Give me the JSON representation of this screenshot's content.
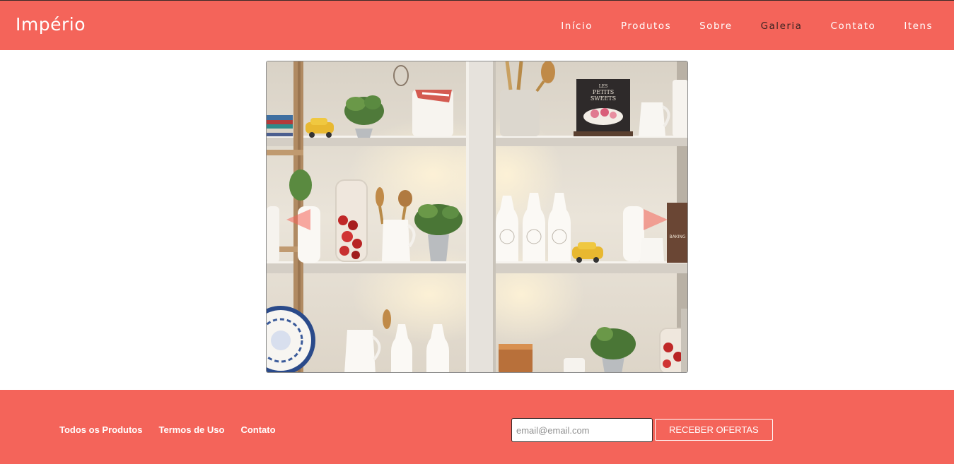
{
  "header": {
    "brand": "Império",
    "nav": [
      {
        "label": "Início"
      },
      {
        "label": "Produtos"
      },
      {
        "label": "Sobre"
      },
      {
        "label": "Galeria"
      },
      {
        "label": "Contato"
      },
      {
        "label": "Itens"
      }
    ],
    "active_index": 3
  },
  "carousel": {
    "prev_icon": "triangle-left",
    "next_icon": "triangle-right",
    "book_title_line1": "LES",
    "book_title_line2": "PETITS",
    "book_title_line3": "SWEETS",
    "book_spine_text": "BAKING"
  },
  "footer": {
    "links": [
      {
        "label": "Todos os Produtos"
      },
      {
        "label": "Termos de Uso"
      },
      {
        "label": "Contato"
      }
    ],
    "email_placeholder": "email@email.com",
    "email_value": "",
    "submit_label": "RECEBER OFERTAS"
  },
  "colors": {
    "brand": "#f4645a",
    "active_nav": "#3b2422",
    "text_on_brand": "#ffffff"
  }
}
